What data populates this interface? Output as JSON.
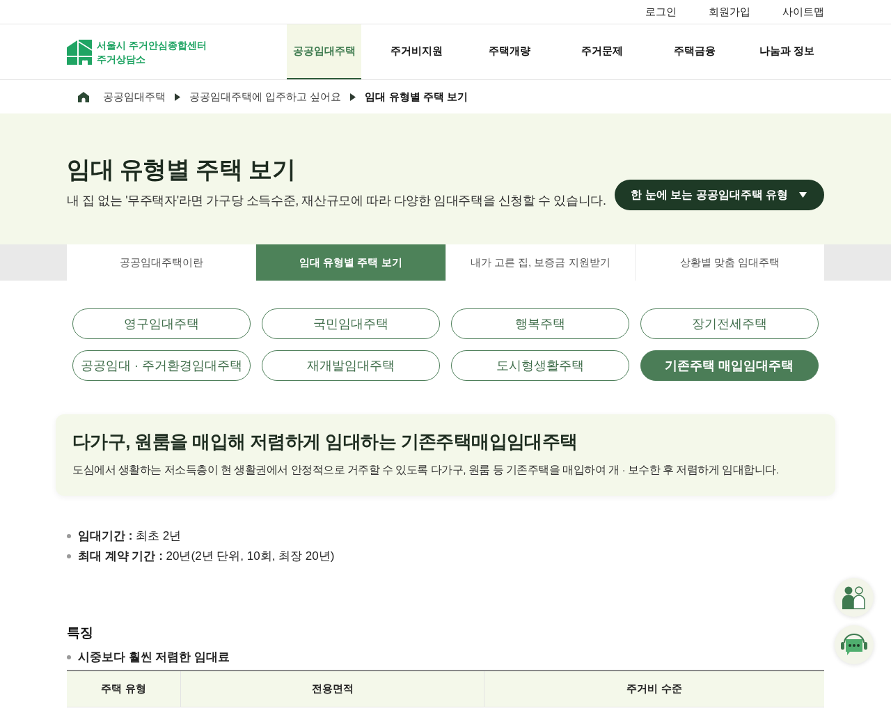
{
  "utility_links": [
    "로그인",
    "회원가입",
    "사이트맵"
  ],
  "header": {
    "logo": {
      "line_1": "서울시 주거안심종합센터",
      "line_2": "주거상담소"
    },
    "nav": [
      {
        "label": "공공임대주택",
        "selected": true
      },
      {
        "label": "주거비지원",
        "selected": false
      },
      {
        "label": "주택개량",
        "selected": false
      },
      {
        "label": "주거문제",
        "selected": false
      },
      {
        "label": "주택금융",
        "selected": false
      },
      {
        "label": "나눔과 정보",
        "selected": false
      }
    ]
  },
  "breadcrumb": [
    {
      "label": "공공임대주택",
      "current": false
    },
    {
      "label": "공공임대주택에 입주하고 싶어요",
      "current": false
    },
    {
      "label": "임대 유형별 주택 보기",
      "current": true
    }
  ],
  "hero": {
    "title": "임대 유형별 주택 보기",
    "subtitle": "내 집 없는 '무주택자'라면 가구당 소득수준, 재산규모에 따라 다양한 임대주택을 신청할 수 있습니다.",
    "button": {
      "label": "한 눈에 보는 공공임대주택 유형"
    }
  },
  "tabs": [
    {
      "label": "공공임대주택이란",
      "selected": false
    },
    {
      "label": "임대 유형별 주택 보기",
      "selected": true
    },
    {
      "label": "내가 고른 집, 보증금 지원받기",
      "selected": false
    },
    {
      "label": "상황별 맞춤 임대주택",
      "selected": false
    }
  ],
  "housing_types": [
    {
      "label": "영구임대주택",
      "selected": false
    },
    {
      "label": "국민임대주택",
      "selected": false
    },
    {
      "label": "행복주택",
      "selected": false
    },
    {
      "label": "장기전세주택",
      "selected": false
    },
    {
      "label": "공공임대 · 주거환경임대주택",
      "selected": false
    },
    {
      "label": "재개발임대주택",
      "selected": false
    },
    {
      "label": "도시형생활주택",
      "selected": false
    },
    {
      "label": "기존주택 매입임대주택",
      "selected": true
    }
  ],
  "intro_card": {
    "title": "다가구, 원룸을 매입해 저렴하게 임대하는 기존주택매입임대주택",
    "description": "도심에서 생활하는 저소득층이 현 생활권에서 안정적으로 거주할 수 있도록 다가구, 원룸 등 기존주택을 매입하여 개 · 보수한 후 저렴하게 임대합니다."
  },
  "terms": [
    "**임대기간 :** 최초 2년",
    "**최대 계약 기간 :** 20년(2년 단위, 10회, 최장 20년)"
  ],
  "features": {
    "heading": "특징",
    "items": [
      "시중보다 훨씬 저렴한 임대료"
    ],
    "table": {
      "columns": [
        "주택 유형",
        "전용면적",
        "주거비 수준"
      ]
    }
  }
}
